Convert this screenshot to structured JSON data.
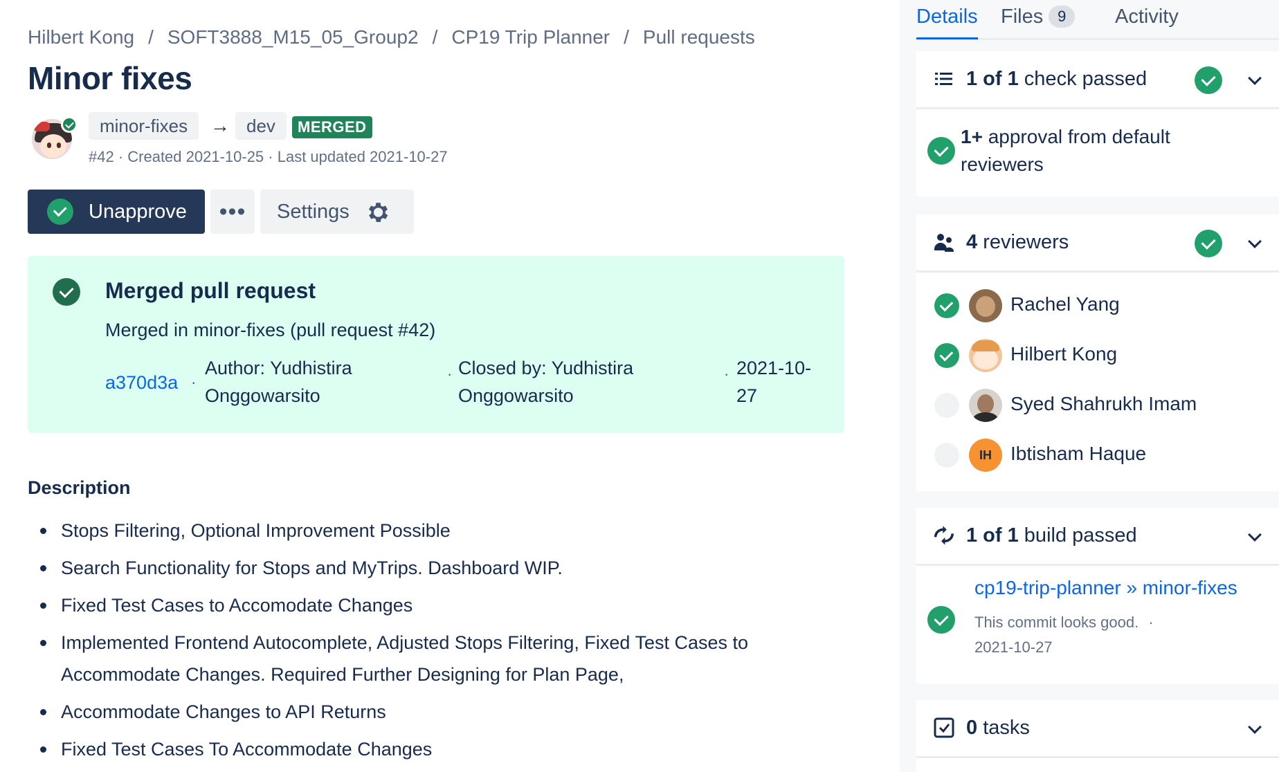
{
  "breadcrumb": {
    "items": [
      "Hilbert Kong",
      "SOFT3888_M15_05_Group2",
      "CP19 Trip Planner",
      "Pull requests"
    ],
    "separator": "/"
  },
  "title": "Minor fixes",
  "pr": {
    "source_branch": "minor-fixes",
    "target_branch": "dev",
    "state": "MERGED",
    "meta": "#42 · Created 2021-10-25 · Last updated 2021-10-27"
  },
  "actions": {
    "unapprove_label": "Unapprove",
    "more_label": "•••",
    "settings_label": "Settings"
  },
  "merged_panel": {
    "title": "Merged pull request",
    "subtitle": "Merged in minor-fixes (pull request #42)",
    "commit": "a370d3a",
    "dot": "·",
    "author_line1": "Author: Yudhistira",
    "author_line2": "Onggowarsito",
    "closed_line1": "Closed by: Yudhistira",
    "closed_line2": "Onggowarsito",
    "date_line1": "2021-10-",
    "date_line2": "27"
  },
  "description": {
    "title": "Description",
    "items": [
      "Stops Filtering, Optional Improvement Possible",
      "Search Functionality for Stops and MyTrips. Dashboard WIP.",
      "Fixed Test Cases to Accomodate Changes",
      "Implemented Frontend Autocomplete, Adjusted Stops Filtering, Fixed Test Cases to Accommodate Changes. Required Further Designing for Plan Page,",
      "Accommodate Changes to API Returns",
      "Fixed Test Cases To Accommodate Changes"
    ]
  },
  "sidebar": {
    "tabs": {
      "details": "Details",
      "files": "Files",
      "files_count": "9",
      "activity": "Activity"
    },
    "checks": {
      "count_bold": "1 of 1",
      "label": " check passed",
      "item_bold": "1+",
      "item_line1": " approval from default",
      "item_line2": "reviewers"
    },
    "reviewers": {
      "count_bold": "4",
      "label": " reviewers",
      "list": [
        {
          "name": "Rachel Yang",
          "approved": true
        },
        {
          "name": "Hilbert Kong",
          "approved": true
        },
        {
          "name": "Syed Shahrukh Imam",
          "approved": false
        },
        {
          "name": "Ibtisham Haque",
          "approved": false,
          "initials": "IH"
        }
      ]
    },
    "builds": {
      "count_bold": "1 of 1",
      "label": " build passed",
      "link": "cp19-trip-planner » minor-fixes",
      "status": "This commit looks good.",
      "dot": "·",
      "date": "2021-10-27"
    },
    "tasks": {
      "count_bold": "0",
      "label": " tasks"
    }
  },
  "colors": {
    "primary_text": "#172b4d",
    "link": "#0c66e4",
    "success": "#22a06b",
    "merged_lozenge": "#1f845a",
    "merged_panel_bg": "#dcfff1",
    "button_dark": "#253858"
  }
}
